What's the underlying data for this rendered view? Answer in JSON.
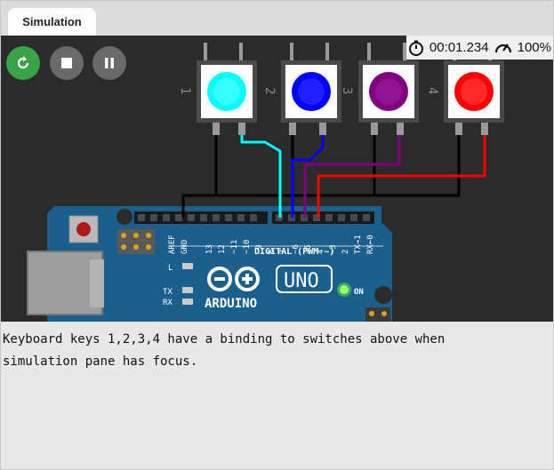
{
  "tabs": {
    "simulation": "Simulation"
  },
  "stats": {
    "timer": "00:01.234",
    "speed": "100%"
  },
  "buttons": {
    "labels": [
      "1",
      "2",
      "3",
      "4"
    ],
    "colors": [
      "#00ffff",
      "#0000ff",
      "#800080",
      "#ff0000"
    ]
  },
  "board": {
    "pins": [
      "AREF",
      "GND",
      "13",
      "12",
      "~11",
      "~10",
      "~9",
      "8",
      "7",
      "~6",
      "~5",
      "4",
      "~3",
      "2",
      "TX→1",
      "RX←0"
    ],
    "digital_label": "DIGITAL (PWM ~)",
    "uno": "UNO",
    "arduino": "ARDUINO",
    "on": "ON",
    "led_l": "L",
    "led_tx": "TX",
    "led_rx": "RX",
    "board_color": "#1b5f8c"
  },
  "console": {
    "line1": "Keyboard keys 1,2,3,4 have a binding to switches above when",
    "line2": "simulation pane has focus."
  }
}
